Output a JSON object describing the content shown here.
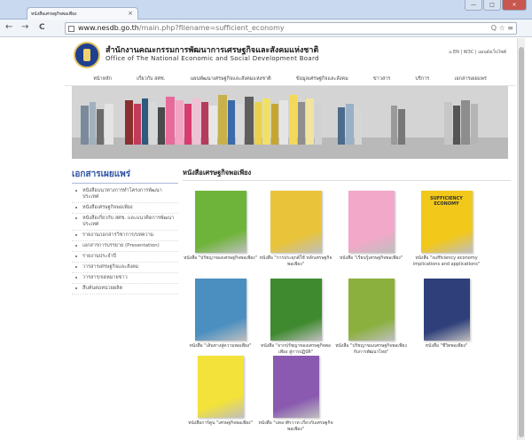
{
  "browser": {
    "tab_title": "หนังสือเศรษฐกิจพอเพียง",
    "tab_close": "×",
    "url_host": "www.nesdb.go.th",
    "url_path": "/main.php?filename=sufficient_economy",
    "url_actions": "Q ☆ ≡",
    "back": "←",
    "forward": "→",
    "reload": "C",
    "minimize": "—",
    "maximize": "□",
    "close": "×"
  },
  "header": {
    "title_th": "สำนักงานคณะกรรมการพัฒนาการเศรษฐกิจและสังคมแห่งชาติ",
    "title_en": "Office of The National Economic and Social Development Board",
    "top_links": "EN | W3C | แผนผังเว็บไซต์"
  },
  "nav": [
    "หน้าหลัก",
    "เกี่ยวกับ สศช.",
    "แผนพัฒนาเศรษฐกิจและสังคมแห่งชาติ",
    "ข้อมูลเศรษฐกิจและสังคม",
    "ข่าวสาร",
    "บริการ",
    "เอกสารเผยแพร่"
  ],
  "sidebar": {
    "title": "เอกสารเผยแพร่",
    "items": [
      "หนังสือแนวทางการทำโครงการพัฒนาประเทศ",
      "หนังสือเศรษฐกิจพอเพียง",
      "หนังสือเกี่ยวกับ สศช. และแนวคิดการพัฒนาประเทศ",
      "รายงาน/เอกสารวิชาการ/บทความ",
      "เอกสารการบรรยาย (Presentation)",
      "รายงานประจำปี",
      "วารสารเศรษฐกิจและสังคม",
      "วารสาร/จดหมายข่าว",
      "สืบค้นต่อหน่วยผลิต"
    ]
  },
  "content": {
    "title": "หนังสือเศรษฐกิจพอเพียง",
    "books": [
      {
        "caption": "หนังสือ \"ปรัชญาของเศรษฐกิจพอเพียง\"",
        "cover_text": "",
        "color": "#6fb43a"
      },
      {
        "caption": "หนังสือ \"การประยุกต์ใช้ หลักเศรษฐกิจพอเพียง\"",
        "cover_text": "",
        "color": "#e9c43a"
      },
      {
        "caption": "หนังสือ \"เรียนรู้เศรษฐกิจพอเพียง\"",
        "cover_text": "",
        "color": "#f2a8c8"
      },
      {
        "caption": "หนังสือ \"sufficiency economy implications and applications\"",
        "cover_text": "SUFFICIENCY ECONOMY",
        "color": "#f2c81a"
      },
      {
        "caption": "หนังสือ \"เส้นทางสู่ความพอเพียง\"",
        "cover_text": "",
        "color": "#4a8fc0"
      },
      {
        "caption": "หนังสือ \"จากปรัชญาของเศรษฐกิจพอเพียง สู่การปฏิบัติ\"",
        "cover_text": "",
        "color": "#3f8a2f"
      },
      {
        "caption": "หนังสือ \"ปรัชญาของเศรษฐกิจพอเพียงกับการพัฒนาไทย\"",
        "cover_text": "",
        "color": "#8bb03e"
      },
      {
        "caption": "หนังสือ \"ชีวิตพอเพียง\"",
        "cover_text": "",
        "color": "#2e3f7a"
      },
      {
        "caption": "หนังสือการ์ตูน \"เศรษฐกิจพอเพียง\"",
        "cover_text": "",
        "color": "#f3e23a"
      },
      {
        "caption": "หนังสือ \"บทอาศิรวาท เกี่ยวกับเศรษฐกิจพอเพียง\"",
        "cover_text": "",
        "color": "#8a5ab0"
      }
    ]
  }
}
